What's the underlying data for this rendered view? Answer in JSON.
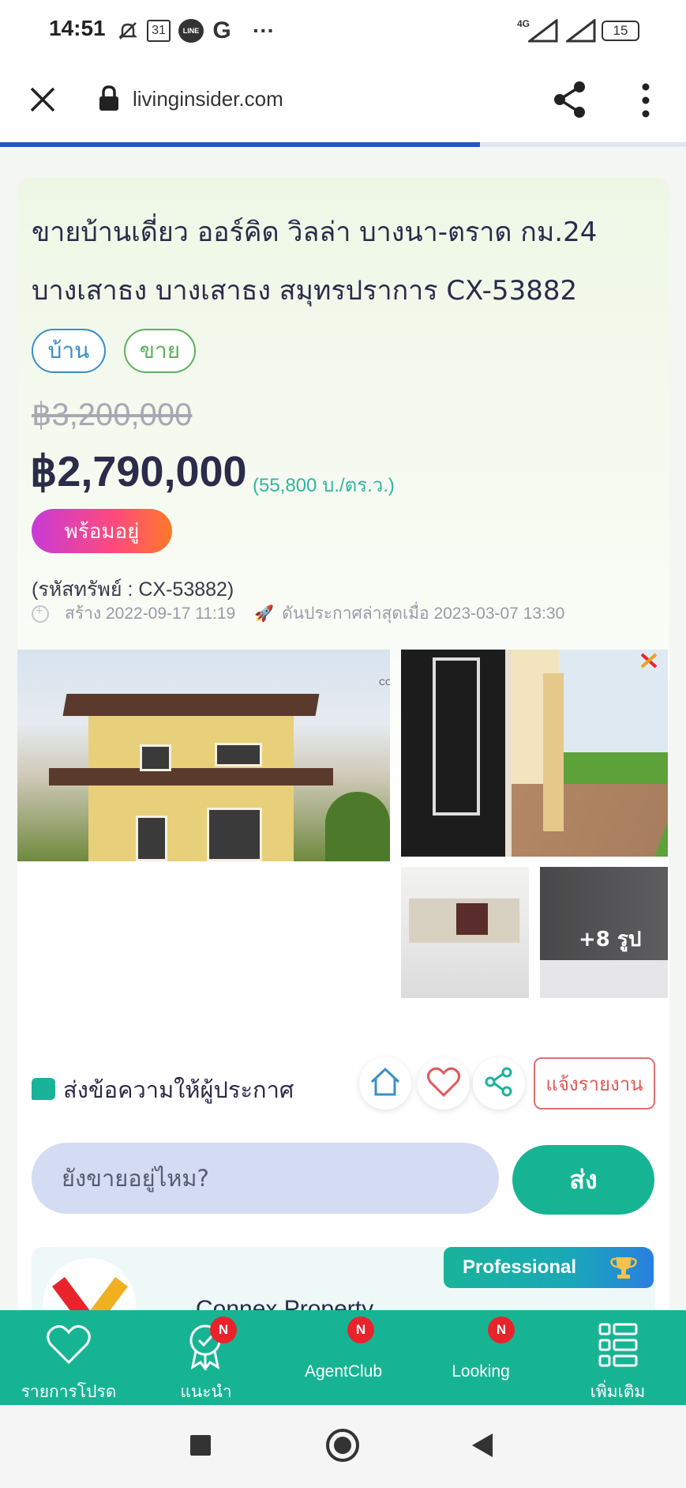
{
  "status_bar": {
    "time": "14:51",
    "calendar_day": "31",
    "line_label": "LINE",
    "google_label": "G",
    "more": "···",
    "network": "4G",
    "battery": "15"
  },
  "browser": {
    "url": "livinginsider.com",
    "load_progress": 0.7
  },
  "listing": {
    "title_line1": "ขายบ้านเดี่ยว ออร์คิด วิลล่า บางนา-ตราด กม.24",
    "title_line2": "บางเสาธง บางเสาธง สมุทรปราการ CX-53882",
    "tags": [
      "บ้าน",
      "ขาย"
    ],
    "old_price": "฿3,200,000",
    "price": "฿2,790,000",
    "price_per_unit": "(55,800 บ./ตร.ว.)",
    "status_badge": "พร้อมอยู่",
    "code": "(รหัสทรัพย์ : CX-53882)",
    "created": "สร้าง 2022-09-17 11:19",
    "bumped": "ดันประกาศล่าสุดเมื่อ 2023-03-07 13:30",
    "more_photos": "+8 รูป",
    "watermark": "CONNEX"
  },
  "message": {
    "label": "ส่งข้อความให้ผู้ประกาศ",
    "report_label": "แจ้งรายงาน",
    "input_value": "ยังขายอยู่ไหม?",
    "send_label": "ส่ง"
  },
  "agent": {
    "badge": "Professional",
    "name": "Connex Property"
  },
  "bottom_nav": {
    "favorites": "รายการโปรด",
    "recommend": "แนะนำ",
    "agentclub": "AgentClub",
    "looking": "Looking",
    "more": "เพิ่มเติม",
    "badge": "N"
  },
  "colors": {
    "brand_green": "#17b494",
    "progress_blue": "#1e5bb8",
    "price_teal": "#2fb6a3",
    "badge_red": "#e8232c"
  }
}
